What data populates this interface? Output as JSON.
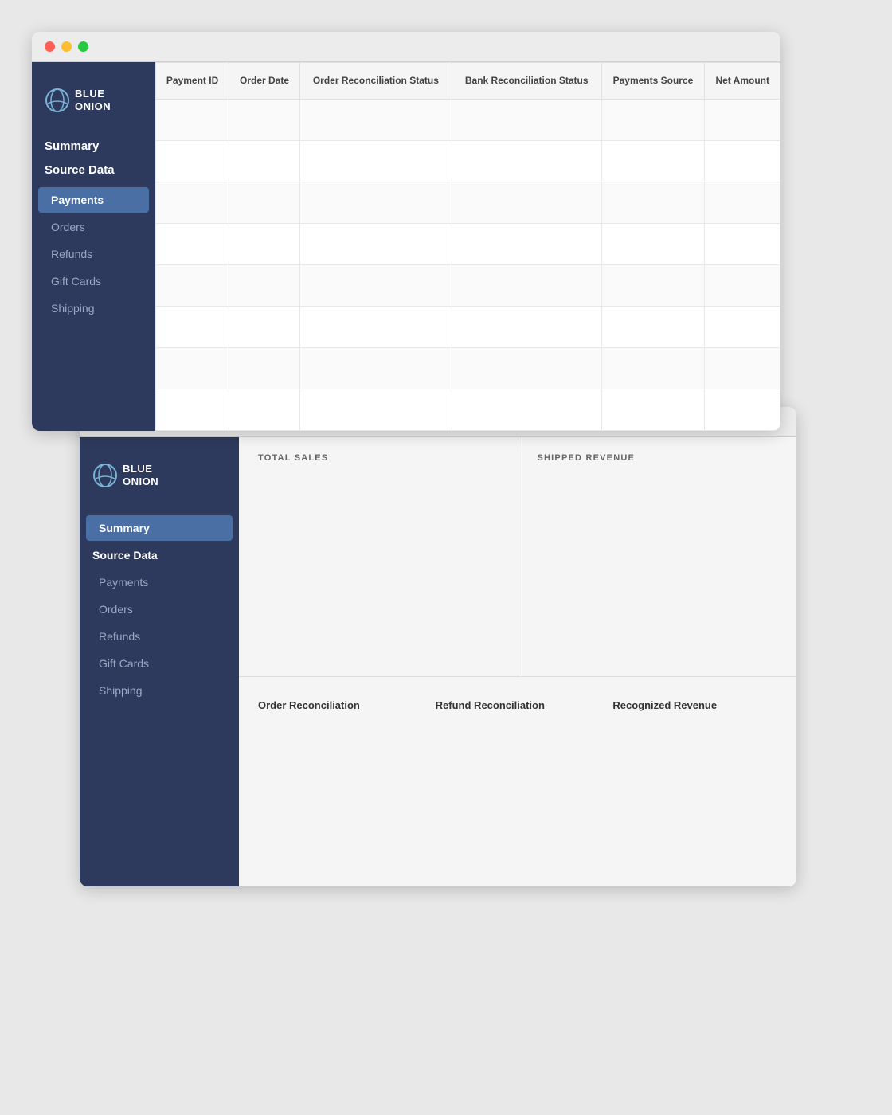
{
  "window1": {
    "logo": {
      "line1": "BLUE",
      "line2": "ONION"
    },
    "sidebar": {
      "section_labels": [
        "Summary",
        "Source Data"
      ],
      "nav_items": [
        {
          "label": "Payments",
          "active": true
        },
        {
          "label": "Orders",
          "active": false
        },
        {
          "label": "Refunds",
          "active": false
        },
        {
          "label": "Gift Cards",
          "active": false
        },
        {
          "label": "Shipping",
          "active": false
        }
      ]
    },
    "table": {
      "columns": [
        {
          "label": "Payment ID"
        },
        {
          "label": "Order Date"
        },
        {
          "label": "Order Reconciliation Status"
        },
        {
          "label": "Bank Reconciliation Status"
        },
        {
          "label": "Payments Source"
        },
        {
          "label": "Net Amount"
        }
      ],
      "rows": 8
    }
  },
  "window2": {
    "logo": {
      "line1": "BLUE",
      "line2": "ONION"
    },
    "sidebar": {
      "section_labels": [
        "Summary",
        "Source Data"
      ],
      "nav_items": [
        {
          "label": "Payments",
          "active": false
        },
        {
          "label": "Orders",
          "active": false
        },
        {
          "label": "Refunds",
          "active": false
        },
        {
          "label": "Gift Cards",
          "active": false
        },
        {
          "label": "Shipping",
          "active": false
        }
      ],
      "active_top": "Summary",
      "bold_item": "Source Data"
    },
    "panels": {
      "left_label": "TOTAL SALES",
      "right_label": "SHIPPED REVENUE"
    },
    "bottom_sections": [
      {
        "label": "Order Reconciliation"
      },
      {
        "label": "Refund Reconciliation"
      },
      {
        "label": "Recognized Revenue"
      }
    ]
  }
}
